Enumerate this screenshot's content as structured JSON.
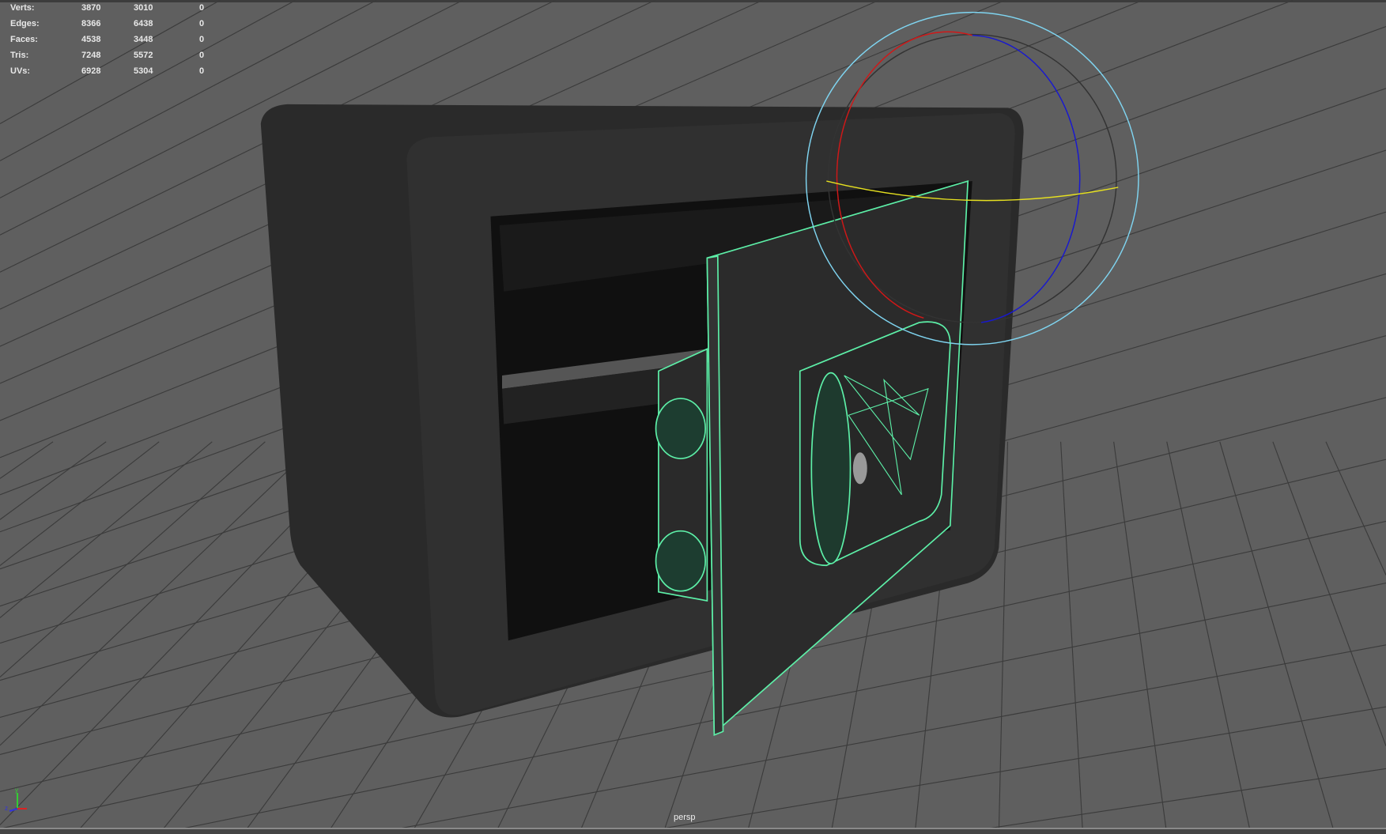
{
  "viewport": {
    "camera_label": "persp",
    "stats": [
      {
        "label": "Verts:",
        "scene": "3870",
        "selected": "3010",
        "uv": "0"
      },
      {
        "label": "Edges:",
        "scene": "8366",
        "selected": "6438",
        "uv": "0"
      },
      {
        "label": "Faces:",
        "scene": "4538",
        "selected": "3448",
        "uv": "0"
      },
      {
        "label": "Tris:",
        "scene": "7248",
        "selected": "5572",
        "uv": "0"
      },
      {
        "label": "UVs:",
        "scene": "6928",
        "selected": "5304",
        "uv": "0"
      }
    ],
    "axis_labels": {
      "y": "y",
      "z": "z"
    },
    "colors": {
      "background": "#5f5f5f",
      "wireframe": "#5df0a8",
      "grid": "#3a3a3a",
      "manip_x": "#d01818",
      "manip_y": "#e6e020",
      "manip_z": "#1818d0",
      "manip_view": "#7fd4f0"
    }
  }
}
